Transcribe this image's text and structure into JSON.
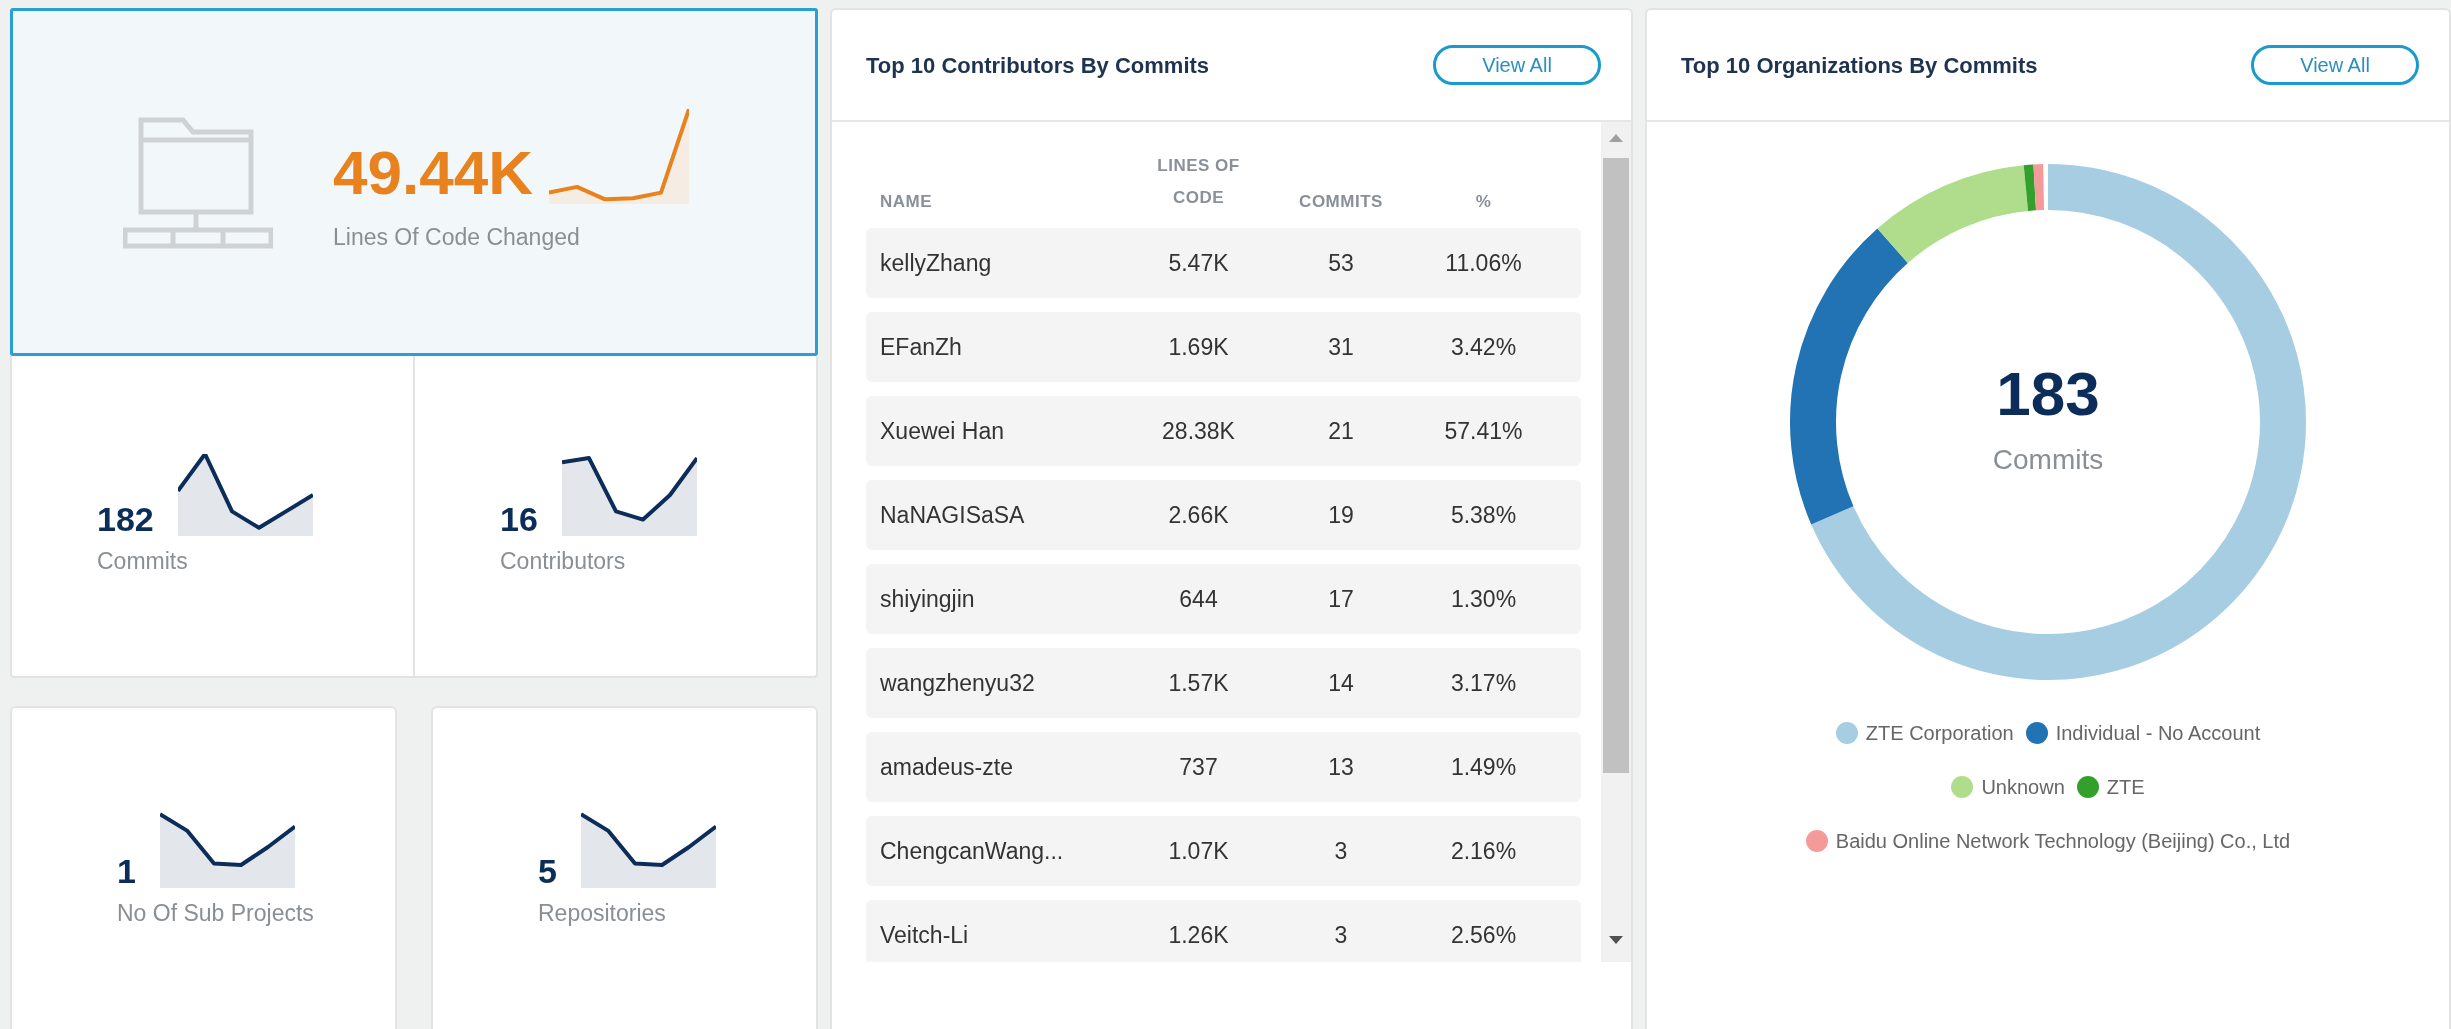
{
  "lines_changed": {
    "value": "49.44K",
    "label": "Lines Of Code Changed"
  },
  "stat_pairs": [
    {
      "value": "182",
      "label": "Commits"
    },
    {
      "value": "16",
      "label": "Contributors"
    }
  ],
  "sub_stats": [
    {
      "value": "1",
      "label": "No Of Sub Projects"
    },
    {
      "value": "5",
      "label": "Repositories"
    }
  ],
  "contributors": {
    "title": "Top 10 Contributors By Commits",
    "button": "View All",
    "columns": [
      "NAME",
      "LINES OF CODE",
      "COMMITS",
      "%"
    ],
    "rows": [
      [
        "kellyZhang",
        "5.47K",
        "53",
        "11.06%"
      ],
      [
        "EFanZh",
        "1.69K",
        "31",
        "3.42%"
      ],
      [
        "Xuewei Han",
        "28.38K",
        "21",
        "57.41%"
      ],
      [
        "NaNAGISaSA",
        "2.66K",
        "19",
        "5.38%"
      ],
      [
        "shiyingjin",
        "644",
        "17",
        "1.30%"
      ],
      [
        "wangzhenyu32",
        "1.57K",
        "14",
        "3.17%"
      ],
      [
        "amadeus-zte",
        "737",
        "13",
        "1.49%"
      ],
      [
        "ChengcanWang...",
        "1.07K",
        "3",
        "2.16%"
      ],
      [
        "Veitch-Li",
        "1.26K",
        "3",
        "2.56%"
      ]
    ]
  },
  "organizations": {
    "title": "Top 10 Organizations By Commits",
    "button": "View All",
    "total": "183",
    "total_label": "Commits",
    "legend": [
      {
        "label": "ZTE Corporation",
        "color": "#a6cde2"
      },
      {
        "label": "Individual - No Account",
        "color": "#2273b3"
      },
      {
        "label": "Unknown",
        "color": "#b0dd8b"
      },
      {
        "label": "ZTE",
        "color": "#33a02c"
      },
      {
        "label": "Baidu Online Network Technology (Beijing) Co., Ltd",
        "color": "#f59a9a"
      }
    ]
  }
}
